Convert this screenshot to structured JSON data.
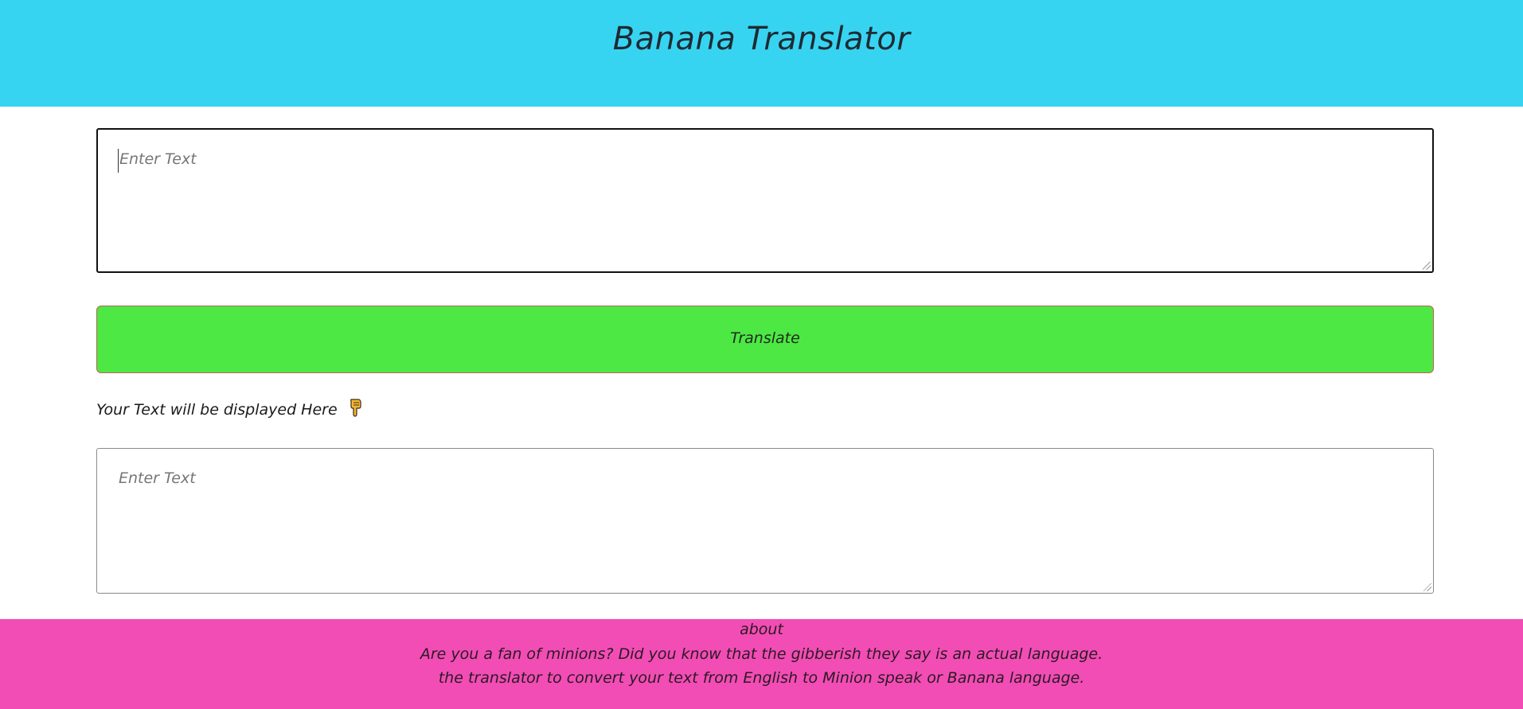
{
  "header": {
    "title": "Banana Translator",
    "bg_color": "#37d4f1"
  },
  "input": {
    "placeholder": "Enter Text",
    "value": ""
  },
  "translate_button": {
    "label": "Translate",
    "bg_color": "#4de844"
  },
  "output_hint": {
    "text": "Your Text will be displayed Here",
    "icon": "pointing-down-hand-icon"
  },
  "output": {
    "placeholder": "Enter Text",
    "value": ""
  },
  "footer": {
    "heading": "about",
    "line1": "Are you a fan of minions? Did you know that the gibberish they say is an actual language.",
    "line2": "the translator to convert your text from English to Minion speak or Banana language.",
    "bg_color": "#f24db4"
  }
}
